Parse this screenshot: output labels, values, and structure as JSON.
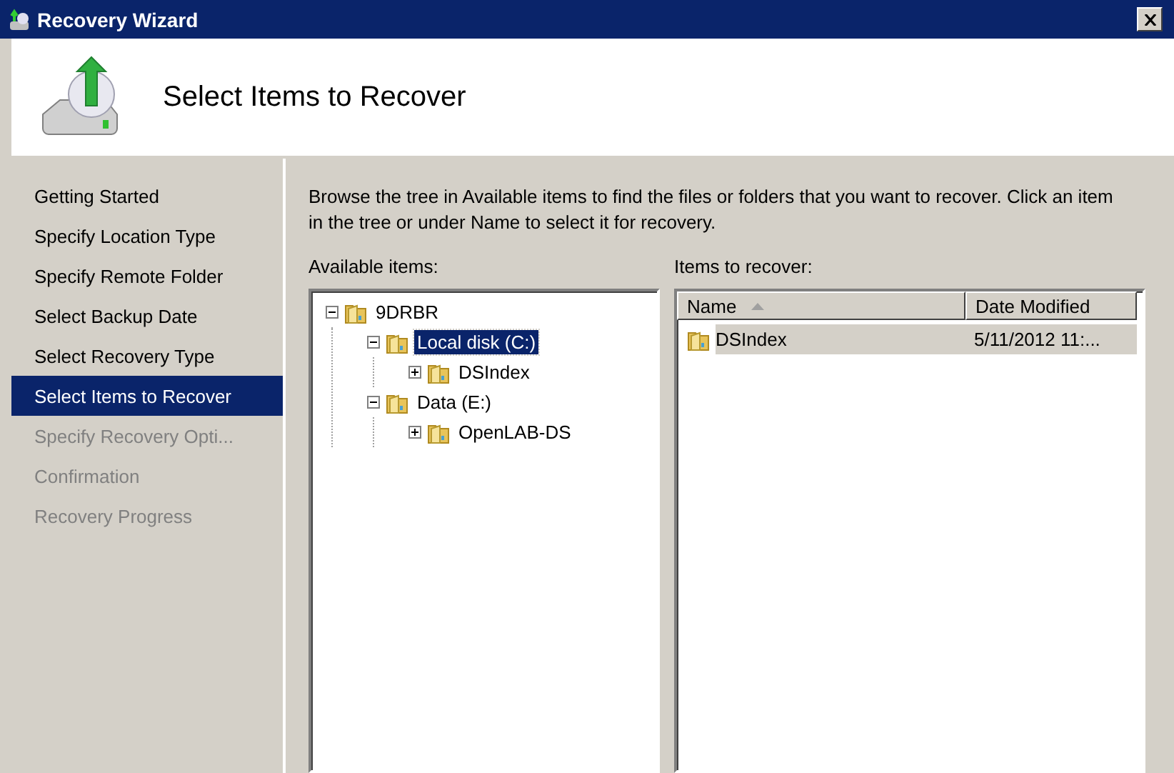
{
  "window": {
    "title": "Recovery Wizard"
  },
  "header": {
    "title": "Select Items to Recover"
  },
  "steps": [
    {
      "label": "Getting Started",
      "selected": false,
      "disabled": false
    },
    {
      "label": "Specify Location Type",
      "selected": false,
      "disabled": false
    },
    {
      "label": "Specify Remote Folder",
      "selected": false,
      "disabled": false
    },
    {
      "label": "Select Backup Date",
      "selected": false,
      "disabled": false
    },
    {
      "label": "Select Recovery Type",
      "selected": false,
      "disabled": false
    },
    {
      "label": "Select Items to Recover",
      "selected": true,
      "disabled": false
    },
    {
      "label": "Specify Recovery Opti...",
      "selected": false,
      "disabled": true
    },
    {
      "label": "Confirmation",
      "selected": false,
      "disabled": true
    },
    {
      "label": "Recovery Progress",
      "selected": false,
      "disabled": true
    }
  ],
  "instructions": "Browse the tree in Available items to find the files or folders that you want to recover. Click an item in the tree or under Name to select it for recovery.",
  "available": {
    "label": "Available items:",
    "tree": [
      {
        "label": "9DRBR",
        "expanded": true,
        "selected": false,
        "children": [
          {
            "label": "Local disk (C:)",
            "expanded": true,
            "selected": true,
            "children": [
              {
                "label": "DSIndex",
                "expanded": false,
                "selected": false
              }
            ]
          },
          {
            "label": "Data (E:)",
            "expanded": true,
            "selected": false,
            "children": [
              {
                "label": "OpenLAB-DS",
                "expanded": false,
                "selected": false
              }
            ]
          }
        ]
      }
    ]
  },
  "recover": {
    "label": "Items to recover:",
    "columns": [
      "Name",
      "Date Modified"
    ],
    "rows": [
      {
        "name": "DSIndex",
        "date": "5/11/2012 11:...",
        "selected": true
      }
    ]
  }
}
